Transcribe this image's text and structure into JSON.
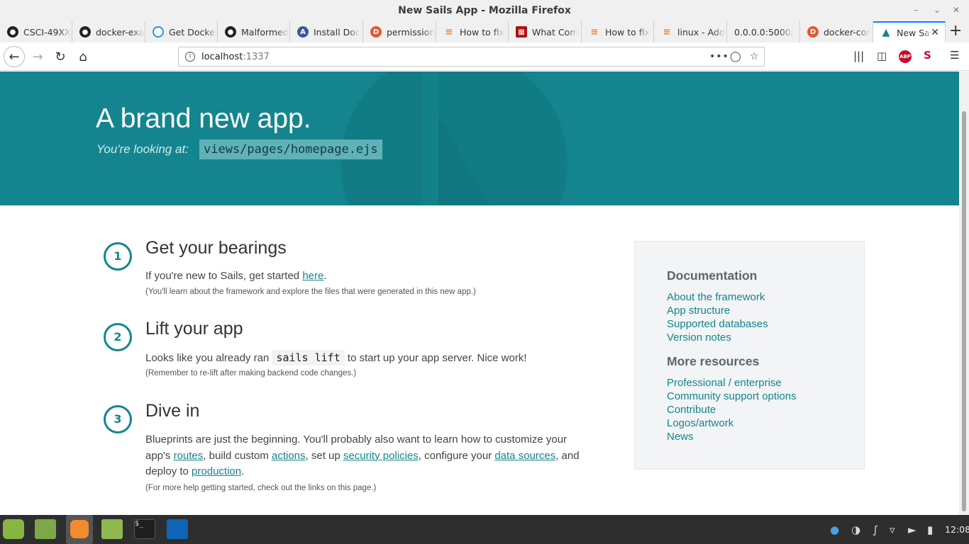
{
  "window": {
    "title": "New Sails App - Mozilla Firefox"
  },
  "tabs": [
    {
      "label": "CSCI-49XX",
      "icon": "github-icon",
      "color": "#222222"
    },
    {
      "label": "docker-exa",
      "icon": "github-icon",
      "color": "#222222"
    },
    {
      "label": "Get Docker",
      "icon": "docker-docs-icon",
      "color": "#2496ed"
    },
    {
      "label": "Malformed",
      "icon": "github-icon",
      "color": "#222222"
    },
    {
      "label": "Install Doc",
      "icon": "install-docs-icon",
      "color": "#3b5998"
    },
    {
      "label": "permission",
      "icon": "duckduckgo-icon",
      "color": "#de5833"
    },
    {
      "label": "How to fix",
      "icon": "stackoverflow-icon",
      "color": "#f48024"
    },
    {
      "label": "What Com",
      "icon": "grid-site-icon",
      "color": "#b01111"
    },
    {
      "label": "How to fix",
      "icon": "stackoverflow-icon",
      "color": "#f48024"
    },
    {
      "label": "linux - Add",
      "icon": "stackoverflow-icon",
      "color": "#f48024"
    },
    {
      "label": "0.0.0.0:5000/",
      "icon": "",
      "color": ""
    },
    {
      "label": "docker-cor",
      "icon": "duckduckgo-icon",
      "color": "#de5833"
    },
    {
      "label": "New Sai",
      "icon": "sails-icon",
      "color": "#14858e"
    }
  ],
  "navbar": {
    "url_host": "localhost",
    "url_port": ":1337"
  },
  "hero": {
    "heading": "A brand new app.",
    "sub_label": "You're looking at:",
    "view_path": "views/pages/homepage.ejs"
  },
  "steps": [
    {
      "number": "1",
      "title": "Get your bearings",
      "text_before": "If you're new to Sails, get started ",
      "link": "here",
      "text_after": ".",
      "note": "(You'll learn about the framework and explore the files that were generated in this new app.)"
    },
    {
      "number": "2",
      "title": "Lift your app",
      "text_before": "Looks like you already ran ",
      "code": "sails lift",
      "text_after": " to start up your app server. Nice work!",
      "note": "(Remember to re-lift after making backend code changes.)"
    },
    {
      "number": "3",
      "title": "Dive in",
      "text_1": "Blueprints are just the beginning. You'll probably also want to learn how to customize your app's ",
      "link_routes": "routes",
      "text_2": ", build custom ",
      "link_actions": "actions",
      "text_3": ", set up ",
      "link_policies": "security policies",
      "text_4": ", configure your ",
      "link_datasources": "data sources",
      "text_5": ", and deploy to ",
      "link_production": "production",
      "text_6": ".",
      "note": "(For more help getting started, check out the links on this page.)"
    }
  ],
  "sidebar": {
    "documentation_heading": "Documentation",
    "documentation_links": [
      "About the framework",
      "App structure",
      "Supported databases",
      "Version notes"
    ],
    "resources_heading": "More resources",
    "resources_links": [
      "Professional / enterprise",
      "Community support options",
      "Contribute",
      "Logos/artwork",
      "News"
    ]
  },
  "taskbar": {
    "clock": "12:08"
  },
  "colors": {
    "accent": "#14858e",
    "hero_bg": "#14858e"
  }
}
